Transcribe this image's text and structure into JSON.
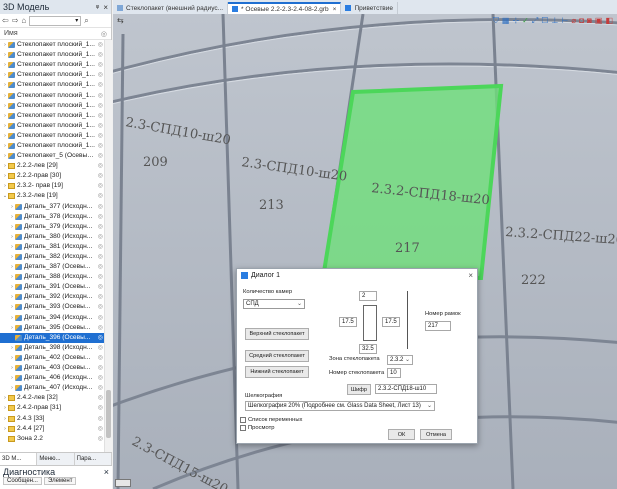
{
  "left_panel": {
    "title": "3D Модель",
    "pin": "ᵠ",
    "close": "×",
    "column_header": "Имя",
    "tree": [
      {
        "label": "Стеклопакет плоский_1...",
        "icon": "part",
        "indent": 0,
        "exp": "›"
      },
      {
        "label": "Стеклопакет плоский_1...",
        "icon": "part",
        "indent": 0,
        "exp": "›"
      },
      {
        "label": "Стеклопакет плоский_1...",
        "icon": "part",
        "indent": 0,
        "exp": "›"
      },
      {
        "label": "Стеклопакет плоский_1...",
        "icon": "part",
        "indent": 0,
        "exp": "›"
      },
      {
        "label": "Стеклопакет плоский_1...",
        "icon": "part",
        "indent": 0,
        "exp": "›"
      },
      {
        "label": "Стеклопакет плоский_1...",
        "icon": "part",
        "indent": 0,
        "exp": "›"
      },
      {
        "label": "Стеклопакет плоский_1...",
        "icon": "part",
        "indent": 0,
        "exp": "›"
      },
      {
        "label": "Стеклопакет плоский_1...",
        "icon": "part",
        "indent": 0,
        "exp": "›"
      },
      {
        "label": "Стеклопакет плоский_1...",
        "icon": "part",
        "indent": 0,
        "exp": "›"
      },
      {
        "label": "Стеклопакет плоский_1...",
        "icon": "part",
        "indent": 0,
        "exp": "›"
      },
      {
        "label": "Стеклопакет плоский_1...",
        "icon": "part",
        "indent": 0,
        "exp": "›"
      },
      {
        "label": "Стеклопакет_5 (Осевые...",
        "icon": "part",
        "indent": 0,
        "exp": "›"
      },
      {
        "label": "2.2.2-лев [29]",
        "icon": "folder",
        "indent": 0,
        "exp": "›"
      },
      {
        "label": "2.2.2-прав [30]",
        "icon": "folder",
        "indent": 0,
        "exp": "›"
      },
      {
        "label": "2.3.2- прав [19]",
        "icon": "folder",
        "indent": 0,
        "exp": "›"
      },
      {
        "label": "2.3.2-лев [19]",
        "icon": "folder",
        "indent": 0,
        "exp": "⌄"
      },
      {
        "label": "Деталь_377 (Исходн...",
        "icon": "part",
        "indent": 1,
        "exp": "›"
      },
      {
        "label": "Деталь_378 (Исходн...",
        "icon": "part",
        "indent": 1,
        "exp": "›"
      },
      {
        "label": "Деталь_379 (Исходн...",
        "icon": "part",
        "indent": 1,
        "exp": "›"
      },
      {
        "label": "Деталь_380 (Исходн...",
        "icon": "part",
        "indent": 1,
        "exp": "›"
      },
      {
        "label": "Деталь_381 (Исходн...",
        "icon": "part",
        "indent": 1,
        "exp": "›"
      },
      {
        "label": "Деталь_382 (Исходн...",
        "icon": "part",
        "indent": 1,
        "exp": "›"
      },
      {
        "label": "Деталь_387 (Осевы...",
        "icon": "part",
        "indent": 1,
        "exp": "›"
      },
      {
        "label": "Деталь_388 (Исходн...",
        "icon": "part",
        "indent": 1,
        "exp": "›"
      },
      {
        "label": "Деталь_391 (Осевы...",
        "icon": "part",
        "indent": 1,
        "exp": "›"
      },
      {
        "label": "Деталь_392 (Исходн...",
        "icon": "part",
        "indent": 1,
        "exp": "›"
      },
      {
        "label": "Деталь_393 (Осевы...",
        "icon": "part",
        "indent": 1,
        "exp": "›"
      },
      {
        "label": "Деталь_394 (Исходн...",
        "icon": "part",
        "indent": 1,
        "exp": "›"
      },
      {
        "label": "Деталь_395 (Осевы...",
        "icon": "part",
        "indent": 1,
        "exp": "›"
      },
      {
        "label": "Деталь_396 (Осевы...",
        "icon": "part",
        "indent": 1,
        "exp": "›",
        "selected": true
      },
      {
        "label": "Деталь_398 (Исходн...",
        "icon": "part",
        "indent": 1,
        "exp": "›"
      },
      {
        "label": "Деталь_402 (Осевы...",
        "icon": "part",
        "indent": 1,
        "exp": "›"
      },
      {
        "label": "Деталь_403 (Осевы...",
        "icon": "part",
        "indent": 1,
        "exp": "›"
      },
      {
        "label": "Деталь_406 (Исходн...",
        "icon": "part",
        "indent": 1,
        "exp": "›"
      },
      {
        "label": "Деталь_407 (Исходн...",
        "icon": "part",
        "indent": 1,
        "exp": "›"
      },
      {
        "label": "2.4.2-лев [32]",
        "icon": "folder",
        "indent": 0,
        "exp": "›"
      },
      {
        "label": "2.4.2-прав [31]",
        "icon": "folder",
        "indent": 0,
        "exp": "›"
      },
      {
        "label": "2.4.3 [33]",
        "icon": "folder",
        "indent": 0,
        "exp": "›"
      },
      {
        "label": "2.4.4 [27]",
        "icon": "folder",
        "indent": 0,
        "exp": "›"
      },
      {
        "label": "Зона 2.2",
        "icon": "folder",
        "indent": 0,
        "exp": ""
      }
    ],
    "bottom_tabs": [
      "3D М...",
      "Меню...",
      "Пара..."
    ],
    "diagnostics": {
      "title": "Диагностика",
      "tabs": [
        "Сообщен...",
        "Элемент"
      ]
    }
  },
  "doc_tabs": [
    {
      "label": "Стеклопакет (внешний радиус...",
      "active": false
    },
    {
      "label": "* Осевые 2.2-2.3-2.4-08-2.grb",
      "active": true
    },
    {
      "label": "Приветствие",
      "active": false
    }
  ],
  "viewport": {
    "labels": [
      {
        "text": "2.3-СПД10-ш20",
        "kind": "big"
      },
      {
        "text": "209",
        "kind": "num"
      },
      {
        "text": "2.3-СПД10-ш20",
        "kind": "big"
      },
      {
        "text": "213",
        "kind": "num"
      },
      {
        "text": "2.3.2-СПД18-ш20",
        "kind": "big"
      },
      {
        "text": "217",
        "kind": "num"
      },
      {
        "text": "2.3.2-СПД22-ш20",
        "kind": "big"
      },
      {
        "text": "222",
        "kind": "num"
      },
      {
        "text": "2.3-СПД15-ш20",
        "kind": "big"
      }
    ],
    "highlight_color": "#6fe07a"
  },
  "dialog": {
    "title": "Диалог 1",
    "close": "×",
    "count_label": "Количество камер",
    "count_value": "СПД",
    "top_value": "2",
    "left_value": "17.5",
    "right_value": "17.5",
    "bottom_value": "32.5",
    "frame_label": "Номер рамок",
    "frame_value": "217",
    "btn_top": "Верхний стеклопакет",
    "btn_middle": "Средний стеклопакет",
    "btn_bottom": "Нижний стеклопакет",
    "zone_label": "Зона стеклопакета",
    "zone_value": "2.3.2",
    "number_label": "Номер стеклопакета",
    "number_value": "10",
    "cipher_btn": "Шифр",
    "cipher_value": "2.3.2-СПД18-ш10",
    "silk_label": "Шелкография",
    "silk_value": "Шелкография 20% (Подробнее см. Glass Data Sheet, Лист 13)",
    "check1": "Список переменных",
    "check2": "Просмотр",
    "ok": "ОК",
    "cancel": "Отмена"
  }
}
